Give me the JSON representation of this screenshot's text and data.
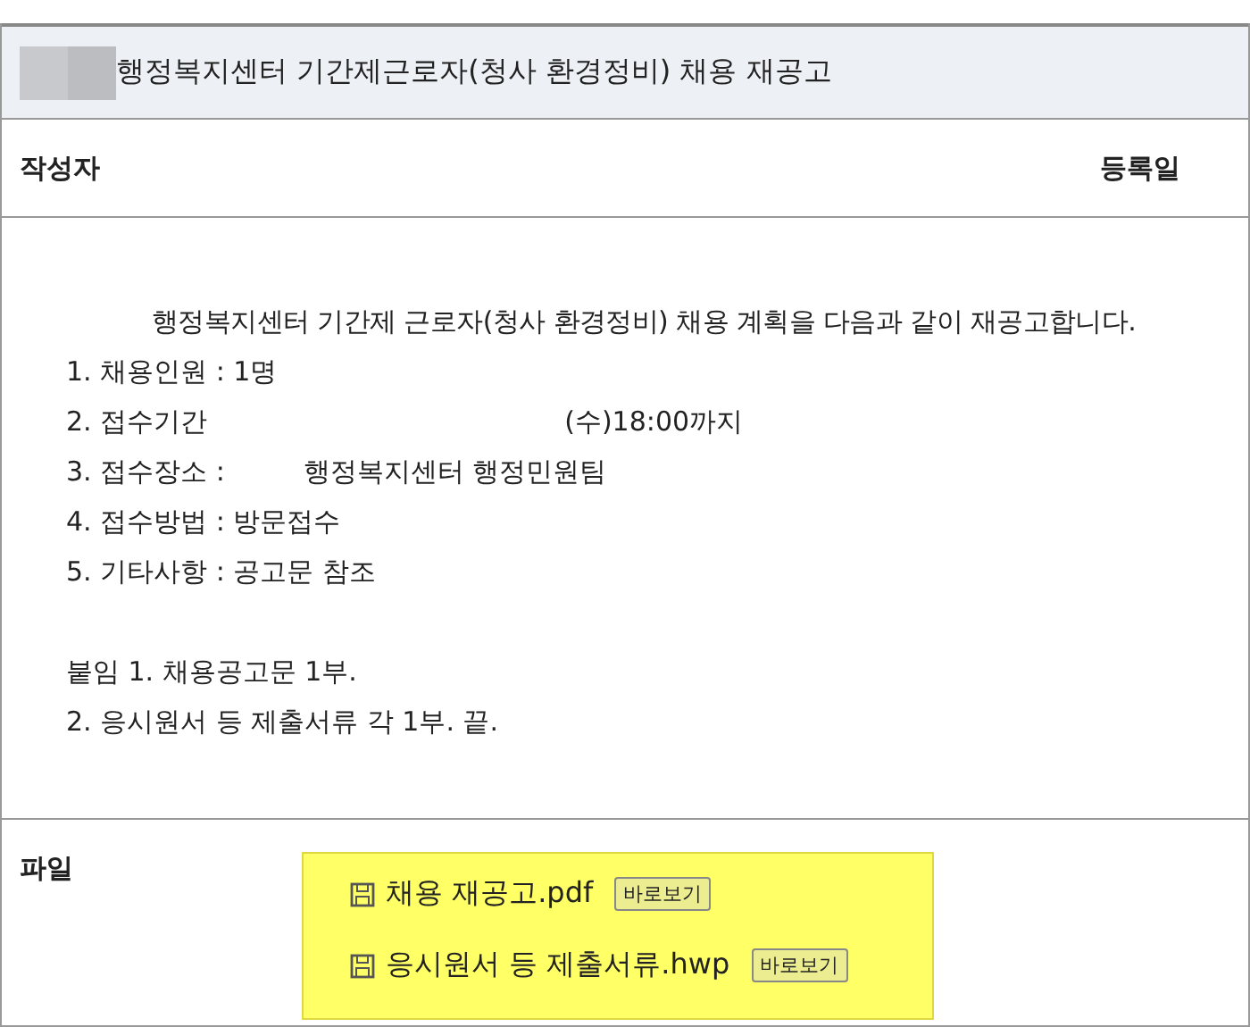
{
  "title": "행정복지센터 기간제근로자(청사 환경정비) 채용 재공고",
  "meta": {
    "author_label": "작성자",
    "date_label": "등록일"
  },
  "body": {
    "intro": "행정복지센터 기간제 근로자(청사 환경정비) 채용 계획을 다음과 같이 재공고합니다.",
    "items": [
      {
        "parts": [
          "1. 채용인원 : 1명"
        ]
      },
      {
        "parts": [
          "2. 접수기간",
          "(수)18:00까지"
        ]
      },
      {
        "parts": [
          "3. 접수장소 :",
          "행정복지센터 행정민원팀"
        ]
      },
      {
        "parts": [
          "4. 접수방법 : 방문접수"
        ]
      },
      {
        "parts": [
          "5. 기타사항 : 공고문 참조"
        ]
      }
    ],
    "attachments": [
      "붙임 1. 채용공고문 1부.",
      "2. 응시원서 등 제출서류 각 1부. 끝."
    ]
  },
  "files": {
    "label": "파일",
    "items": [
      {
        "name": "채용 재공고.pdf",
        "action": "바로보기"
      },
      {
        "name": "응시원서 등 제출서류.hwp",
        "action": "바로보기"
      }
    ]
  }
}
